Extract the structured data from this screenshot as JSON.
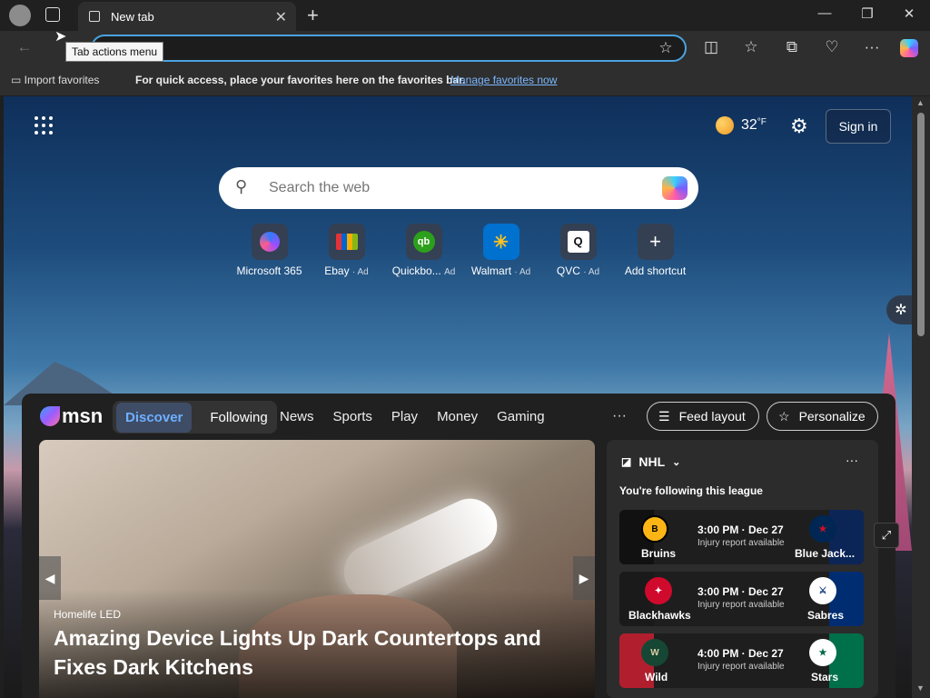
{
  "tab": {
    "title": "New tab"
  },
  "tooltip": "Tab actions menu",
  "favorites_bar": {
    "import_label": "Import favorites",
    "message": "For quick access, place your favorites here on the favorites bar.",
    "manage_link": "Manage favorites now"
  },
  "header": {
    "temperature": "32",
    "temp_unit": "°F",
    "sign_in": "Sign in"
  },
  "search": {
    "placeholder": "Search the web"
  },
  "shortcuts": [
    {
      "label": "Microsoft 365",
      "ad": "",
      "icon": "microsoft-365-icon"
    },
    {
      "label": "Ebay",
      "ad": "· Ad",
      "icon": "ebay-icon"
    },
    {
      "label": "Quickbo...",
      "ad": "Ad",
      "icon": "quickbooks-icon"
    },
    {
      "label": "Walmart",
      "ad": "· Ad",
      "icon": "walmart-icon"
    },
    {
      "label": "QVC",
      "ad": "· Ad",
      "icon": "qvc-icon"
    },
    {
      "label": "Add shortcut",
      "ad": "",
      "icon": "plus-icon"
    }
  ],
  "feed": {
    "logo": "msn",
    "segments": [
      "Discover",
      "Following"
    ],
    "nav": [
      "News",
      "Sports",
      "Play",
      "Money",
      "Gaming"
    ],
    "more": "···",
    "feed_layout": "Feed layout",
    "personalize": "Personalize"
  },
  "hero": {
    "source": "Homelife LED",
    "title": "Amazing Device Lights Up Dark Countertops and Fixes Dark Kitchens"
  },
  "sports": {
    "league": "NHL",
    "following": "You're following this league",
    "games": [
      {
        "home": "Bruins",
        "away": "Blue Jack...",
        "time": "3:00 PM · Dec 27",
        "note": "Injury report available",
        "home_color": "#111111",
        "away_color": "#0b2557"
      },
      {
        "home": "Blackhawks",
        "away": "Sabres",
        "time": "3:00 PM · Dec 27",
        "note": "Injury report available",
        "home_color": "#1a1a1a",
        "away_color": "#002d72"
      },
      {
        "home": "Wild",
        "away": "Stars",
        "time": "4:00 PM · Dec 27",
        "note": "Injury report available",
        "home_color": "#b11f2f",
        "away_color": "#00704a"
      }
    ]
  }
}
